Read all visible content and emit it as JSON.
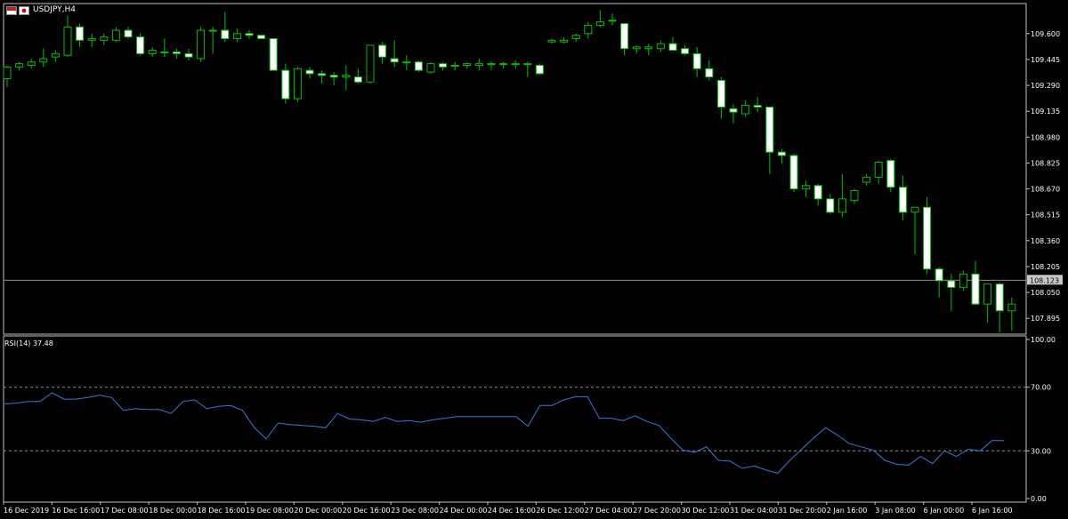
{
  "title": "USDJPY,H4",
  "icons": {
    "flag1": "us-flag-icon",
    "flag2": "jp-flag-icon"
  },
  "colors": {
    "background": "#000000",
    "axis": "#c0c0c0",
    "bull": "#00c000",
    "bear_body": "#ffffff",
    "rsi_line": "#3c78d8",
    "level_line": "#909090",
    "price_line": "#8a8a8a"
  },
  "chart_data": [
    {
      "type": "candlestick",
      "title": "USDJPY,H4",
      "ylim": [
        107.8,
        109.78
      ],
      "yticks": [
        109.6,
        109.445,
        109.29,
        109.135,
        108.98,
        108.825,
        108.67,
        108.515,
        108.36,
        108.205,
        108.05,
        107.895
      ],
      "ytick_labels": [
        "109.600",
        "109.445",
        "109.290",
        "109.135",
        "108.980",
        "108.825",
        "108.670",
        "108.515",
        "108.360",
        "108.205",
        "108.050",
        "107.895"
      ],
      "current_price": 108.123,
      "current_price_label": "108.123",
      "candles": [
        [
          109.33,
          109.41,
          109.28,
          109.4
        ],
        [
          109.4,
          109.43,
          109.38,
          109.42
        ],
        [
          109.41,
          109.45,
          109.39,
          109.43
        ],
        [
          109.43,
          109.51,
          109.4,
          109.45
        ],
        [
          109.46,
          109.5,
          109.43,
          109.48
        ],
        [
          109.47,
          109.71,
          109.46,
          109.64
        ],
        [
          109.64,
          109.66,
          109.52,
          109.56
        ],
        [
          109.56,
          109.6,
          109.52,
          109.57
        ],
        [
          109.56,
          109.6,
          109.53,
          109.58
        ],
        [
          109.56,
          109.64,
          109.55,
          109.62
        ],
        [
          109.62,
          109.64,
          109.57,
          109.58
        ],
        [
          109.58,
          109.6,
          109.47,
          109.48
        ],
        [
          109.48,
          109.52,
          109.46,
          109.5
        ],
        [
          109.49,
          109.57,
          109.46,
          109.49
        ],
        [
          109.49,
          109.51,
          109.45,
          109.48
        ],
        [
          109.48,
          109.51,
          109.44,
          109.46
        ],
        [
          109.45,
          109.64,
          109.43,
          109.62
        ],
        [
          109.62,
          109.64,
          109.48,
          109.62
        ],
        [
          109.62,
          109.73,
          109.55,
          109.57
        ],
        [
          109.57,
          109.63,
          109.55,
          109.6
        ],
        [
          109.6,
          109.62,
          109.57,
          109.59
        ],
        [
          109.59,
          109.59,
          109.57,
          109.57
        ],
        [
          109.57,
          109.57,
          109.38,
          109.38
        ],
        [
          109.38,
          109.42,
          109.18,
          109.21
        ],
        [
          109.21,
          109.4,
          109.19,
          109.39
        ],
        [
          109.38,
          109.4,
          109.33,
          109.36
        ],
        [
          109.36,
          109.38,
          109.3,
          109.35
        ],
        [
          109.35,
          109.37,
          109.29,
          109.34
        ],
        [
          109.34,
          109.41,
          109.26,
          109.35
        ],
        [
          109.34,
          109.39,
          109.3,
          109.31
        ],
        [
          109.31,
          109.53,
          109.3,
          109.53
        ],
        [
          109.53,
          109.55,
          109.42,
          109.46
        ],
        [
          109.45,
          109.56,
          109.4,
          109.43
        ],
        [
          109.43,
          109.47,
          109.38,
          109.43
        ],
        [
          109.43,
          109.44,
          109.37,
          109.38
        ],
        [
          109.37,
          109.43,
          109.36,
          109.42
        ],
        [
          109.42,
          109.43,
          109.38,
          109.4
        ],
        [
          109.41,
          109.43,
          109.38,
          109.41
        ],
        [
          109.41,
          109.43,
          109.39,
          109.42
        ],
        [
          109.41,
          109.45,
          109.38,
          109.42
        ],
        [
          109.42,
          109.43,
          109.38,
          109.42
        ],
        [
          109.42,
          109.43,
          109.39,
          109.42
        ],
        [
          109.42,
          109.44,
          109.39,
          109.42
        ],
        [
          109.42,
          109.43,
          109.34,
          109.42
        ],
        [
          109.41,
          109.42,
          109.35,
          109.36
        ],
        [
          109.55,
          109.57,
          109.54,
          109.56
        ],
        [
          109.55,
          109.58,
          109.54,
          109.56
        ],
        [
          109.57,
          109.6,
          109.55,
          109.59
        ],
        [
          109.6,
          109.67,
          109.57,
          109.65
        ],
        [
          109.65,
          109.74,
          109.64,
          109.67
        ],
        [
          109.68,
          109.72,
          109.65,
          109.68
        ],
        [
          109.66,
          109.66,
          109.47,
          109.51
        ],
        [
          109.51,
          109.53,
          109.48,
          109.52
        ],
        [
          109.51,
          109.54,
          109.47,
          109.52
        ],
        [
          109.51,
          109.56,
          109.49,
          109.54
        ],
        [
          109.54,
          109.58,
          109.51,
          109.5
        ],
        [
          109.51,
          109.53,
          109.47,
          109.48
        ],
        [
          109.48,
          109.52,
          109.34,
          109.39
        ],
        [
          109.39,
          109.44,
          109.32,
          109.34
        ],
        [
          109.32,
          109.34,
          109.09,
          109.16
        ],
        [
          109.15,
          109.18,
          109.06,
          109.13
        ],
        [
          109.12,
          109.2,
          109.1,
          109.17
        ],
        [
          109.17,
          109.22,
          109.13,
          109.16
        ],
        [
          109.16,
          109.16,
          108.76,
          108.89
        ],
        [
          108.89,
          108.91,
          108.82,
          108.87
        ],
        [
          108.87,
          108.88,
          108.65,
          108.67
        ],
        [
          108.67,
          108.72,
          108.62,
          108.69
        ],
        [
          108.69,
          108.7,
          108.57,
          108.61
        ],
        [
          108.61,
          108.64,
          108.52,
          108.53
        ],
        [
          108.53,
          108.76,
          108.5,
          108.61
        ],
        [
          108.6,
          108.67,
          108.58,
          108.66
        ],
        [
          108.71,
          108.76,
          108.69,
          108.74
        ],
        [
          108.74,
          108.84,
          108.7,
          108.83
        ],
        [
          108.84,
          108.85,
          108.65,
          108.68
        ],
        [
          108.68,
          108.75,
          108.48,
          108.53
        ],
        [
          108.53,
          108.56,
          108.28,
          108.56
        ],
        [
          108.56,
          108.62,
          108.16,
          108.19
        ],
        [
          108.19,
          108.2,
          108.02,
          108.12
        ],
        [
          108.12,
          108.16,
          107.94,
          108.08
        ],
        [
          108.08,
          108.18,
          108.06,
          108.16
        ],
        [
          108.16,
          108.24,
          108.0,
          107.98
        ],
        [
          107.98,
          108.1,
          107.87,
          108.1
        ],
        [
          108.1,
          108.11,
          107.81,
          107.94
        ],
        [
          107.94,
          108.02,
          107.82,
          107.98
        ],
        [
          107.98,
          108.1,
          107.94,
          108.08
        ],
        [
          108.08,
          108.17,
          107.97,
          108.04
        ],
        [
          108.04,
          108.16,
          108.02,
          108.15
        ],
        [
          108.13,
          108.16,
          108.1,
          108.12
        ]
      ]
    },
    {
      "type": "line",
      "title": "RSI(14) 37.48",
      "ylim": [
        0,
        100
      ],
      "yticks": [
        100,
        70,
        30,
        0
      ],
      "ytick_labels": [
        "100.00",
        "70.00",
        "30.00",
        "0.00"
      ],
      "levels": [
        70,
        30
      ],
      "series": [
        {
          "name": "RSI(14)",
          "values": [
            59.5,
            60,
            61,
            61,
            66.5,
            62.5,
            62.5,
            63.5,
            65,
            63.5,
            55.5,
            56.5,
            56,
            56,
            53.5,
            61,
            62,
            56.5,
            58,
            58.5,
            55.5,
            44.5,
            37.5,
            47.5,
            46.5,
            46,
            45.5,
            44.5,
            53.5,
            50,
            49.5,
            48.5,
            51,
            48.5,
            49,
            48,
            49.5,
            50.5,
            51.5,
            51.5,
            51.5,
            51.5,
            51.5,
            51.5,
            45.5,
            58.5,
            58.5,
            62,
            64,
            64,
            50.5,
            50.5,
            49,
            52,
            48.5,
            46,
            38,
            30.5,
            29,
            32.5,
            24,
            23.5,
            19,
            20.5,
            18,
            16,
            24,
            31,
            38,
            44.5,
            40,
            34.5,
            32.5,
            30.5,
            24,
            21.5,
            21,
            26.5,
            22,
            30,
            26.5,
            31,
            30,
            36.5,
            36.5
          ]
        }
      ]
    }
  ],
  "xaxis": {
    "labels": [
      "16 Dec 2019",
      "16 Dec 16:00",
      "17 Dec 08:00",
      "18 Dec 00:00",
      "18 Dec 16:00",
      "19 Dec 08:00",
      "20 Dec 00:00",
      "20 Dec 16:00",
      "23 Dec 08:00",
      "24 Dec 00:00",
      "24 Dec 16:00",
      "26 Dec 12:00",
      "27 Dec 04:00",
      "27 Dec 20:00",
      "30 Dec 12:00",
      "31 Dec 04:00",
      "31 Dec 20:00",
      "2 Jan 16:00",
      "3 Jan 08:00",
      "6 Jan 00:00",
      "6 Jan 16:00"
    ],
    "label_candle_index": [
      0,
      4,
      8,
      12,
      16,
      20,
      24,
      28,
      32,
      36,
      40,
      44,
      48,
      52,
      56,
      60,
      64,
      68,
      72,
      76,
      80
    ]
  }
}
